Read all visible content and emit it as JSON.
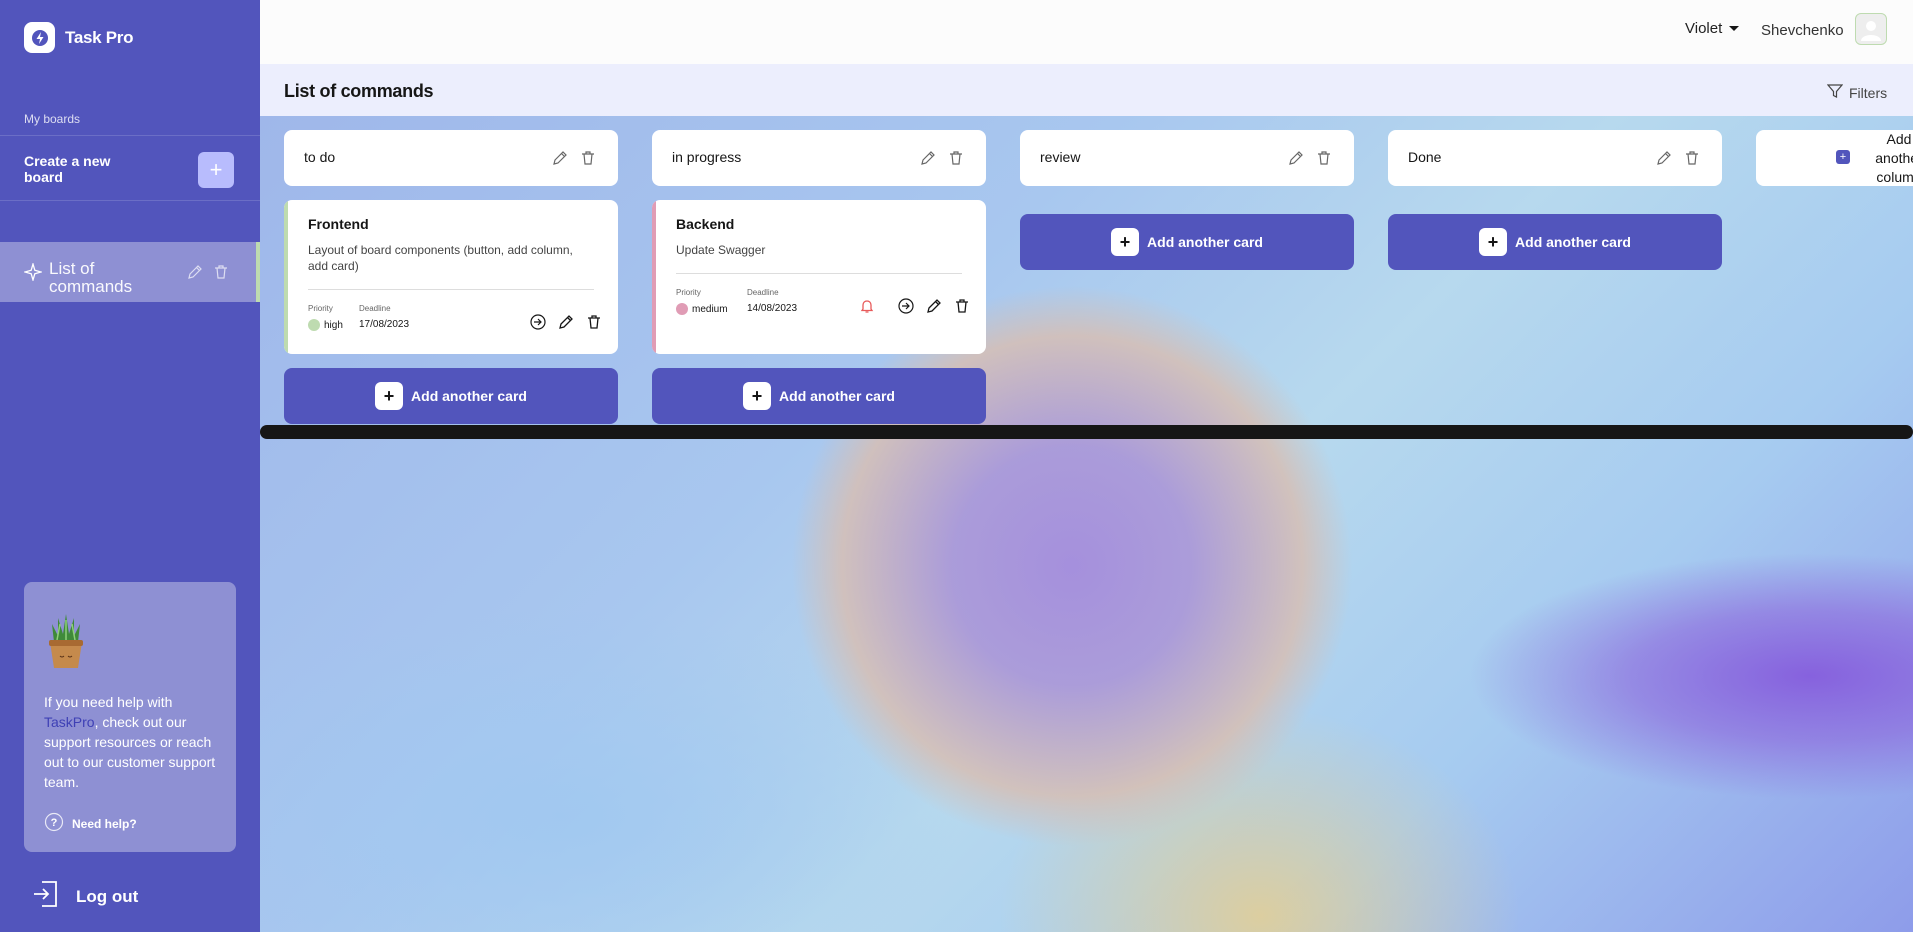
{
  "app": {
    "name": "Task Pro"
  },
  "sidebar": {
    "my_boards_label": "My boards",
    "create_board_label": "Create a new board",
    "boards": [
      {
        "title": "List of commands"
      }
    ],
    "help": {
      "text_before": "If you need help with ",
      "text_link": "TaskPro",
      "text_after": ", check out our support resources or reach out to our customer support team.",
      "need_help_label": "Need help?"
    },
    "logout_label": "Log out"
  },
  "header": {
    "theme": "Violet",
    "username": "Shevchenko"
  },
  "board": {
    "title": "List of commands",
    "filters_label": "Filters",
    "add_card_label": "Add another card",
    "add_column_label": "Add another column",
    "columns": [
      {
        "title": "to do",
        "cards": [
          {
            "title": "Frontend",
            "description": "Layout of board components (button, add column, add card)",
            "priority_label": "Priority",
            "priority": "high",
            "priority_color": "#bedbb0",
            "deadline_label": "Deadline",
            "deadline": "17/08/2023"
          }
        ]
      },
      {
        "title": "in progress",
        "cards": [
          {
            "title": "Backend",
            "description": "Update Swagger",
            "priority_label": "Priority",
            "priority": "medium",
            "priority_color": "#e09cb5",
            "deadline_label": "Deadline",
            "deadline": "14/08/2023"
          }
        ]
      },
      {
        "title": "review",
        "cards": []
      },
      {
        "title": "Done",
        "cards": []
      }
    ]
  },
  "colors": {
    "accent": "#5255bc",
    "sidebar_bg": "#5255bc",
    "high_priority": "#bedbb0",
    "medium_priority": "#e09cb5",
    "bell": "#e85a5a"
  }
}
